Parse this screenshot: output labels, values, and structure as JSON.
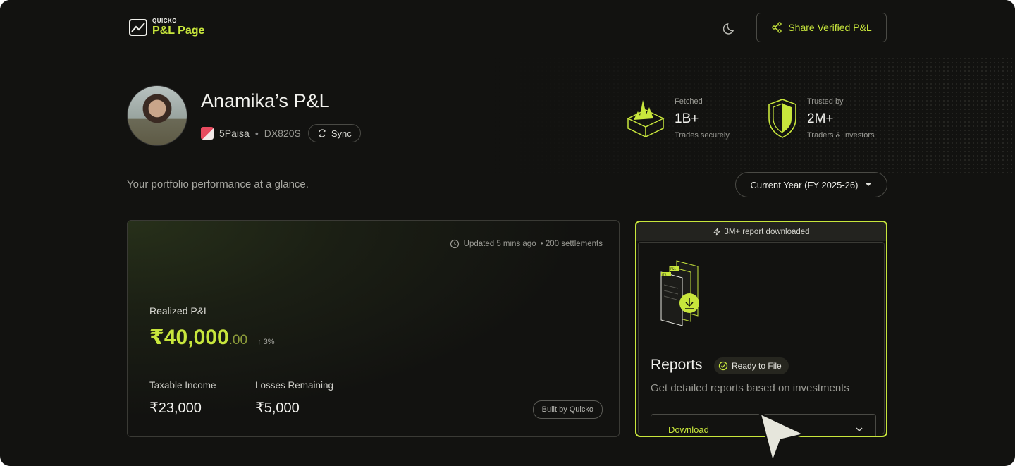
{
  "header": {
    "logo_small": "QUICKO",
    "logo_big": "P&L Page",
    "share_label": "Share Verified P&L",
    "icons": [
      "chart-logo-icon",
      "moon-icon",
      "share-icon"
    ]
  },
  "profile": {
    "title": "Anamika’s P&L",
    "broker": "5Paisa",
    "separator": "•",
    "client_id": "DX820S",
    "sync_label": "Sync"
  },
  "stats": [
    {
      "label": "Fetched",
      "value": "1B+",
      "sub": "Trades securely",
      "icon": "trades-box-icon"
    },
    {
      "label": "Trusted by",
      "value": "2M+",
      "sub": "Traders & Investors",
      "icon": "shield-icon"
    }
  ],
  "tagline": "Your portfolio performance at a glance.",
  "period_select": {
    "value": "Current Year (FY 2025-26)"
  },
  "pl_card": {
    "updated": "Updated 5 mins ago",
    "settlements": "• 200 settlements",
    "realized_label": "Realized P&L",
    "realized_main": "₹40,000",
    "realized_decimal": ".00",
    "realized_change": "↑ 3%",
    "taxable_label": "Taxable Income",
    "taxable_value": "₹23,000",
    "losses_label": "Losses Remaining",
    "losses_value": "₹5,000",
    "built_label": "Built by Quicko"
  },
  "reports_card": {
    "banner": "3M+ report downloaded",
    "title": "Reports",
    "badge": "Ready to File",
    "description": "Get detailed reports based on investments",
    "download_label": "Download",
    "doc_labels": [
      "P&L",
      "ITR"
    ]
  },
  "colors": {
    "accent": "#c8e63c",
    "background": "#121210",
    "border": "#3a3a35"
  }
}
